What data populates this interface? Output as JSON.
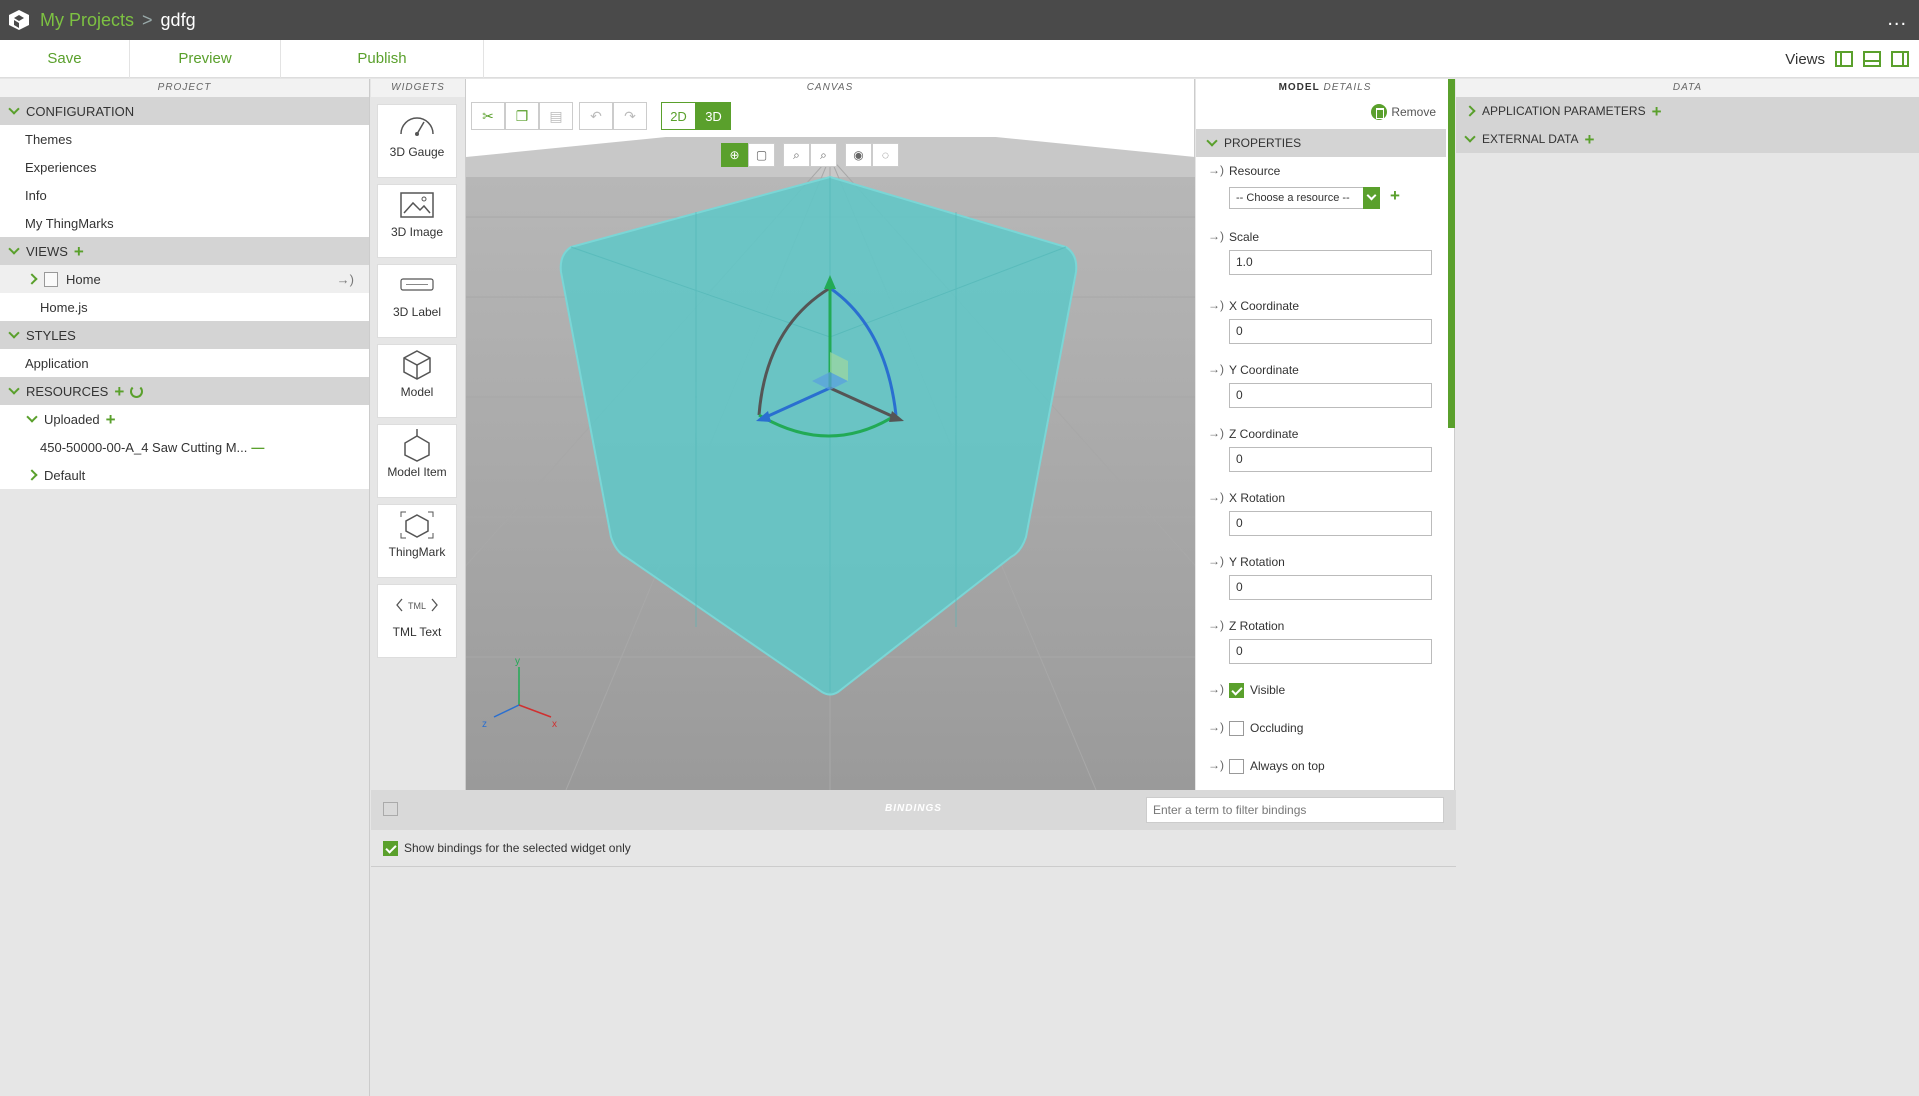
{
  "titlebar": {
    "breadcrumb_link": "My Projects",
    "separator": ">",
    "project_name": "gdfg",
    "more": "..."
  },
  "toolbar": {
    "save": "Save",
    "preview": "Preview",
    "publish": "Publish",
    "views_label": "Views"
  },
  "panels": {
    "project": "PROJECT",
    "widgets": "WIDGETS",
    "canvas": "CANVAS",
    "details_a": "MODEL",
    "details_b": "DETAILS",
    "data": "DATA"
  },
  "project": {
    "configuration": "CONFIGURATION",
    "config_items": [
      "Themes",
      "Experiences",
      "Info",
      "My ThingMarks"
    ],
    "views": "VIEWS",
    "view_home": "Home",
    "view_home_js": "Home.js",
    "styles": "STYLES",
    "style_app": "Application",
    "resources": "RESOURCES",
    "uploaded": "Uploaded",
    "uploaded_file": "450-50000-00-A_4 Saw Cutting M...",
    "default": "Default"
  },
  "widgets": [
    "3D Gauge",
    "3D Image",
    "3D Label",
    "Model",
    "Model Item",
    "ThingMark",
    "TML Text"
  ],
  "canvas": {
    "btn_2d": "2D",
    "btn_3d": "3D",
    "axis_x": "x",
    "axis_y": "y",
    "axis_z": "z"
  },
  "details": {
    "remove": "Remove",
    "properties": "PROPERTIES",
    "resource_label": "Resource",
    "resource_placeholder": "-- Choose a resource --",
    "scale_label": "Scale",
    "scale_value": "1.0",
    "x_coord_label": "X Coordinate",
    "x_coord_value": "0",
    "y_coord_label": "Y Coordinate",
    "y_coord_value": "0",
    "z_coord_label": "Z Coordinate",
    "z_coord_value": "0",
    "x_rot_label": "X Rotation",
    "x_rot_value": "0",
    "y_rot_label": "Y Rotation",
    "y_rot_value": "0",
    "z_rot_label": "Z Rotation",
    "z_rot_value": "0",
    "visible_label": "Visible",
    "occluding_label": "Occluding",
    "ontop_label": "Always on top"
  },
  "data_panel": {
    "app_params": "APPLICATION PARAMETERS",
    "external_data": "EXTERNAL DATA"
  },
  "bindings": {
    "title": "BINDINGS",
    "filter_placeholder": "Enter a term to filter bindings",
    "selected_only": "Show bindings for the selected widget only"
  },
  "colors": {
    "accent": "#5aa02c",
    "titlebar": "#4a4a4a",
    "cube": "#5ec8c8"
  }
}
